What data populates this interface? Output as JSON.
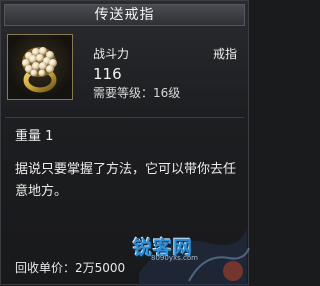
{
  "title": "传送戒指",
  "item": {
    "icon": "gold-pearl-ring-icon",
    "stat_label": "战斗力",
    "type_label": "戒指",
    "stat_value": "116",
    "level_requirement": "需要等级：16级",
    "weight": "重量 1",
    "description": "据说只要掌握了方法，它可以带你去任意地方。",
    "sell_price": "回收单价：2万5000"
  },
  "watermark": {
    "text": "锐客网",
    "url": "8090yxs.com"
  },
  "colors": {
    "background": "#1a1b1d",
    "titlebar": "#3a3b40",
    "gold": "#c9a53a",
    "watermark_blue": "#2f8fd6"
  }
}
